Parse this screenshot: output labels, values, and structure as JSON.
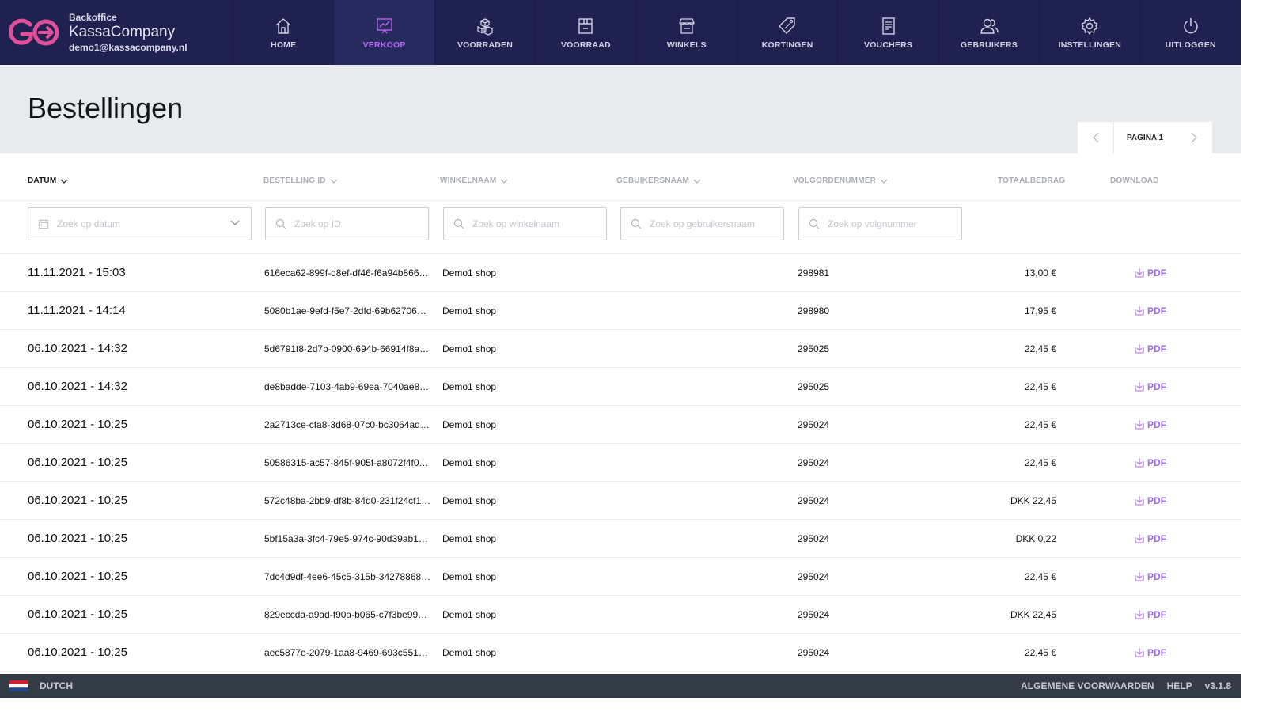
{
  "brand": {
    "subtitle": "Backoffice",
    "name": "KassaCompany",
    "email": "demo1@kassacompany.nl",
    "logo_text": "GO",
    "accent": "#e0509a"
  },
  "nav": [
    {
      "label": "HOME",
      "icon": "home-icon"
    },
    {
      "label": "VERKOOP",
      "icon": "chart-icon",
      "active": true
    },
    {
      "label": "VOORRADEN",
      "icon": "stock-icon"
    },
    {
      "label": "VOORRAAD",
      "icon": "box-icon"
    },
    {
      "label": "WINKELS",
      "icon": "store-icon"
    },
    {
      "label": "KORTINGEN",
      "icon": "tag-icon"
    },
    {
      "label": "VOUCHERS",
      "icon": "receipt-icon"
    },
    {
      "label": "GEBRUIKERS",
      "icon": "users-icon"
    },
    {
      "label": "INSTELLINGEN",
      "icon": "gear-icon"
    },
    {
      "label": "UITLOGGEN",
      "icon": "power-icon"
    }
  ],
  "page": {
    "title": "Bestellingen",
    "pager_label": "PAGINA 1"
  },
  "columns": {
    "date": "DATUM",
    "order_id": "BESTELLING ID",
    "shop": "WINKELNAAM",
    "user": "GEBUIKERSNAAM",
    "seq": "VOLGORDENUMMER",
    "total": "TOTAALBEDRAG",
    "download": "DOWNLOAD"
  },
  "filters": {
    "date": "Zoek op datum",
    "id": "Zoek op ID",
    "shop": "Zoek op winkelnaam",
    "user": "Zoek op gebruikersnaam",
    "seq": "Zoek op volgnummer"
  },
  "rows": [
    {
      "date": "11.11.2021 - 15:03",
      "id": "616eca62-899f-d8ef-df46-f6a94b866…",
      "shop": "Demo1 shop",
      "seq": "298981",
      "total": "13,00 €",
      "pdf": "PDF"
    },
    {
      "date": "11.11.2021 - 14:14",
      "id": "5080b1ae-9efd-f5e7-2dfd-69b62706…",
      "shop": "Demo1 shop",
      "seq": "298980",
      "total": "17,95 €",
      "pdf": "PDF"
    },
    {
      "date": "06.10.2021 - 14:32",
      "id": "5d6791f8-2d7b-0900-694b-66914f8a…",
      "shop": "Demo1 shop",
      "seq": "295025",
      "total": "22,45 €",
      "pdf": "PDF"
    },
    {
      "date": "06.10.2021 - 14:32",
      "id": "de8badde-7103-4ab9-69ea-7040ae8…",
      "shop": "Demo1 shop",
      "seq": "295025",
      "total": "22,45 €",
      "pdf": "PDF"
    },
    {
      "date": "06.10.2021 - 10:25",
      "id": "2a2713ce-cfa8-3d68-07c0-bc3064ad…",
      "shop": "Demo1 shop",
      "seq": "295024",
      "total": "22,45 €",
      "pdf": "PDF"
    },
    {
      "date": "06.10.2021 - 10:25",
      "id": "50586315-ac57-845f-905f-a8072f4f0…",
      "shop": "Demo1 shop",
      "seq": "295024",
      "total": "22,45 €",
      "pdf": "PDF"
    },
    {
      "date": "06.10.2021 - 10:25",
      "id": "572c48ba-2bb9-df8b-84d0-231f24cf1…",
      "shop": "Demo1 shop",
      "seq": "295024",
      "total": "DKK 22,45",
      "pdf": "PDF"
    },
    {
      "date": "06.10.2021 - 10:25",
      "id": "5bf15a3a-3fc4-79e5-974c-90d39ab1…",
      "shop": "Demo1 shop",
      "seq": "295024",
      "total": "DKK 0,22",
      "pdf": "PDF"
    },
    {
      "date": "06.10.2021 - 10:25",
      "id": "7dc4d9df-4ee6-45c5-315b-34278868…",
      "shop": "Demo1 shop",
      "seq": "295024",
      "total": "22,45 €",
      "pdf": "PDF"
    },
    {
      "date": "06.10.2021 - 10:25",
      "id": "829eccda-a9ad-f90a-b065-c7f3be99…",
      "shop": "Demo1 shop",
      "seq": "295024",
      "total": "DKK 22,45",
      "pdf": "PDF"
    },
    {
      "date": "06.10.2021 - 10:25",
      "id": "aec5877e-2079-1aa8-9469-693c551…",
      "shop": "Demo1 shop",
      "seq": "295024",
      "total": "22,45 €",
      "pdf": "PDF"
    }
  ],
  "footer": {
    "language": "DUTCH",
    "terms": "ALGEMENE VOORWAARDEN",
    "help": "HELP",
    "version": "v3.1.8"
  }
}
